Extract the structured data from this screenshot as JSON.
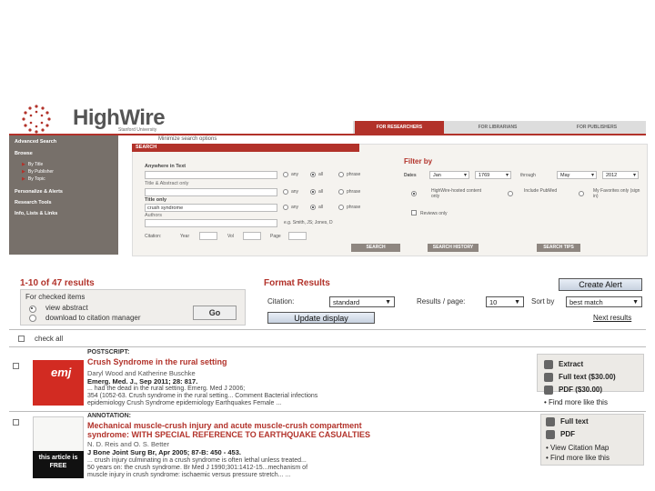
{
  "header": {
    "brand": "HighWire",
    "brand_sub": "Stanford University",
    "tabs": [
      "FOR RESEARCHERS",
      "FOR LIBRARIANS",
      "FOR PUBLISHERS"
    ]
  },
  "sidebar": {
    "advanced_search": "Advanced Search",
    "browse": "Browse",
    "browse_items": [
      "By Title",
      "By Publisher",
      "By Topic"
    ],
    "personalize": "Personalize & Alerts",
    "research_tools": "Research Tools",
    "info": "Info, Lists & Links"
  },
  "search": {
    "minimize": "Minimize search options",
    "header": "SEARCH",
    "anywhere_label": "Anywhere in Text",
    "title_abstract_label": "Title & Abstract only",
    "title_only_label": "Title only",
    "title_only_value": "crush syndrome",
    "authors_label": "Authors",
    "authors_hint": "e.g. Smith, JS; Jones, D",
    "radio_any": "any",
    "radio_all": "all",
    "radio_phrase": "phrase",
    "citation_label": "Citation:",
    "year_label": "Year",
    "vol_label": "Vol",
    "page_label": "Page",
    "search_btn": "SEARCH",
    "history_btn": "SEARCH HISTORY",
    "tips_btn": "SEARCH TIPS"
  },
  "filter": {
    "title": "Filter by",
    "dates_label": "Dates",
    "from_month": "Jan",
    "from_year": "1769",
    "through_label": "through",
    "to_month": "May",
    "to_year": "2012",
    "opt1": "HighWire-hosted content only",
    "opt2": "Include PubMed",
    "opt3": "My Favorites only (sign in)",
    "reviews": "Reviews only"
  },
  "results": {
    "count": "1-10 of 47 results",
    "for_checked": "For checked items",
    "view_abstract": "view abstract",
    "download": "download to citation manager",
    "go": "Go",
    "check_all": "check all",
    "format_title": "Format Results",
    "citation_label": "Citation:",
    "citation_value": "standard",
    "per_page_label": "Results / page:",
    "per_page_value": "10",
    "sort_label": "Sort by",
    "sort_value": "best match",
    "create_alert": "Create Alert",
    "update_display": "Update display",
    "next_results": "Next results"
  },
  "items": [
    {
      "type": "POSTSCRIPT:",
      "title": "Crush Syndrome in the rural setting",
      "authors": "Daryl Wood and Katherine Buschke",
      "citation": "Emerg. Med. J., Sep 2011; 28: 817.",
      "snippet1": "... had the dead in the rural setting. Emerg. Med J 2006;",
      "snippet2": "354 (1052-63. Crush syndrome in the rural setting... Comment Bacterial infections",
      "snippet3": "epidemiology Crush Syndrome epidemiology Earthquakes Female ...",
      "thumb_text": "emj",
      "links": [
        "Extract",
        "Full text ($30.00)",
        "PDF ($30.00)",
        "Find more like this"
      ]
    },
    {
      "type": "ANNOTATION:",
      "title": "Mechanical muscle-crush injury and acute muscle-crush compartment",
      "title2": "syndrome: WITH SPECIAL REFERENCE TO EARTHQUAKE CASUALTIES",
      "authors": "N. D. Reis and O. S. Better",
      "citation": "J Bone Joint Surg Br, Apr 2005; 87-B: 450 - 453.",
      "snippet1": "... crush injury culminating in a crush syndrome is often lethal unless treated...",
      "snippet2": "50 years on: the crush syndrome. Br Med J 1990;301:1412-15...mechanism of",
      "snippet3": "muscle injury in crush syndrome: ischaemic versus pressure stretch... ...",
      "free_text": "this article is FREE",
      "links": [
        "Full text",
        "PDF",
        "View Citation Map",
        "Find more like this"
      ]
    }
  ],
  "colors": {
    "brand_red": "#b2322a",
    "sidebar_gray": "#77706a"
  }
}
